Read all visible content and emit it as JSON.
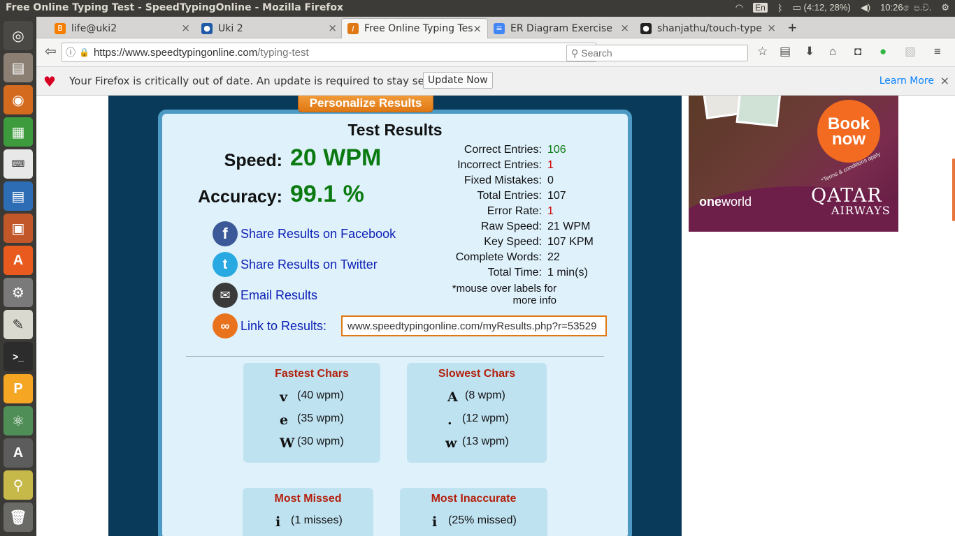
{
  "os": {
    "window_title": "Free Online Typing Test - SpeedTypingOnline - Mozilla Firefox",
    "lang": "En",
    "battery": "(4:12, 28%)",
    "clock": "10:26 ෙප.ව."
  },
  "launcher": {
    "items": [
      "dash-icon",
      "files-icon",
      "firefox-icon",
      "calc-icon",
      "keyboard-icon",
      "writer-icon",
      "impress-icon",
      "software-center-icon",
      "settings-icon",
      "text-editor-icon",
      "terminal-icon",
      "pidgin-icon",
      "atom-icon",
      "updater-icon",
      "image-viewer-icon",
      "trash-icon"
    ]
  },
  "tabs": [
    {
      "label": "life@uki2",
      "icon": "blogger-icon",
      "color": "#f57d00"
    },
    {
      "label": "Uki 2",
      "icon": "user-icon",
      "color": "#1e5aa8"
    },
    {
      "label": "Free Online Typing Tes",
      "icon": "typing-icon",
      "color": "#e07914",
      "active": true
    },
    {
      "label": "ER Diagram Exercise - (",
      "icon": "docs-icon",
      "color": "#4285f4"
    },
    {
      "label": "shanjathu/touch-type",
      "icon": "github-icon",
      "color": "#222222"
    }
  ],
  "nav": {
    "url_host": "https://www.speedtypingonline.com",
    "url_path": "/typing-test",
    "search_placeholder": "Search"
  },
  "notice": {
    "message": "Your Firefox is critically out of date. An update is required to stay secure",
    "button": "Update Now",
    "learn_more": "Learn More"
  },
  "results": {
    "personalize_label": "Personalize Results",
    "title": "Test Results",
    "speed_label": "Speed:",
    "speed_value": "20 WPM",
    "accuracy_label": "Accuracy:",
    "accuracy_value": "99.1 %",
    "share_facebook": "Share Results on Facebook",
    "share_twitter": "Share Results on Twitter",
    "email": "Email Results",
    "link_label": "Link to Results:",
    "link_value": "www.speedtypingonline.com/myResults.php?r=53529",
    "stats": [
      {
        "key": "Correct Entries:",
        "value": "106",
        "color": "#0a7a10"
      },
      {
        "key": "Incorrect Entries:",
        "value": "1",
        "color": "#cc0000"
      },
      {
        "key": "Fixed Mistakes:",
        "value": "0",
        "color": "#111111"
      },
      {
        "key": "Total Entries:",
        "value": "107",
        "color": "#111111"
      },
      {
        "key": "Error Rate:",
        "value": "1",
        "color": "#cc0000"
      },
      {
        "key": "Raw Speed:",
        "value": "21 WPM",
        "color": "#111111"
      },
      {
        "key": "Key Speed:",
        "value": "107 KPM",
        "color": "#111111"
      },
      {
        "key": "Complete Words:",
        "value": "22",
        "color": "#111111"
      },
      {
        "key": "Total Time:",
        "value": "1 min(s)",
        "color": "#111111"
      }
    ],
    "note_line1": "*mouse over labels for",
    "note_line2": "more info",
    "fastest": {
      "title": "Fastest Chars",
      "rows": [
        {
          "char": "v",
          "wpm": "(40 wpm)"
        },
        {
          "char": "e",
          "wpm": "(35 wpm)"
        },
        {
          "char": "W",
          "wpm": "(30 wpm)"
        }
      ]
    },
    "slowest": {
      "title": "Slowest Chars",
      "rows": [
        {
          "char": "A",
          "wpm": "(8 wpm)"
        },
        {
          "char": ".",
          "wpm": "(12 wpm)"
        },
        {
          "char": "w",
          "wpm": "(13 wpm)"
        }
      ]
    },
    "missed": {
      "title": "Most Missed",
      "rows": [
        {
          "char": "i",
          "wpm": "(1 misses)"
        }
      ]
    },
    "inaccurate": {
      "title": "Most Inaccurate",
      "rows": [
        {
          "char": "i",
          "wpm": "(25% missed)"
        }
      ]
    }
  },
  "ad": {
    "book_line1": "Book",
    "book_line2": "now",
    "terms": "*Terms & conditions apply",
    "oneworld_a": "one",
    "oneworld_b": "world",
    "brand_line1": "QATAR",
    "brand_line2": "AIRWAYS"
  }
}
